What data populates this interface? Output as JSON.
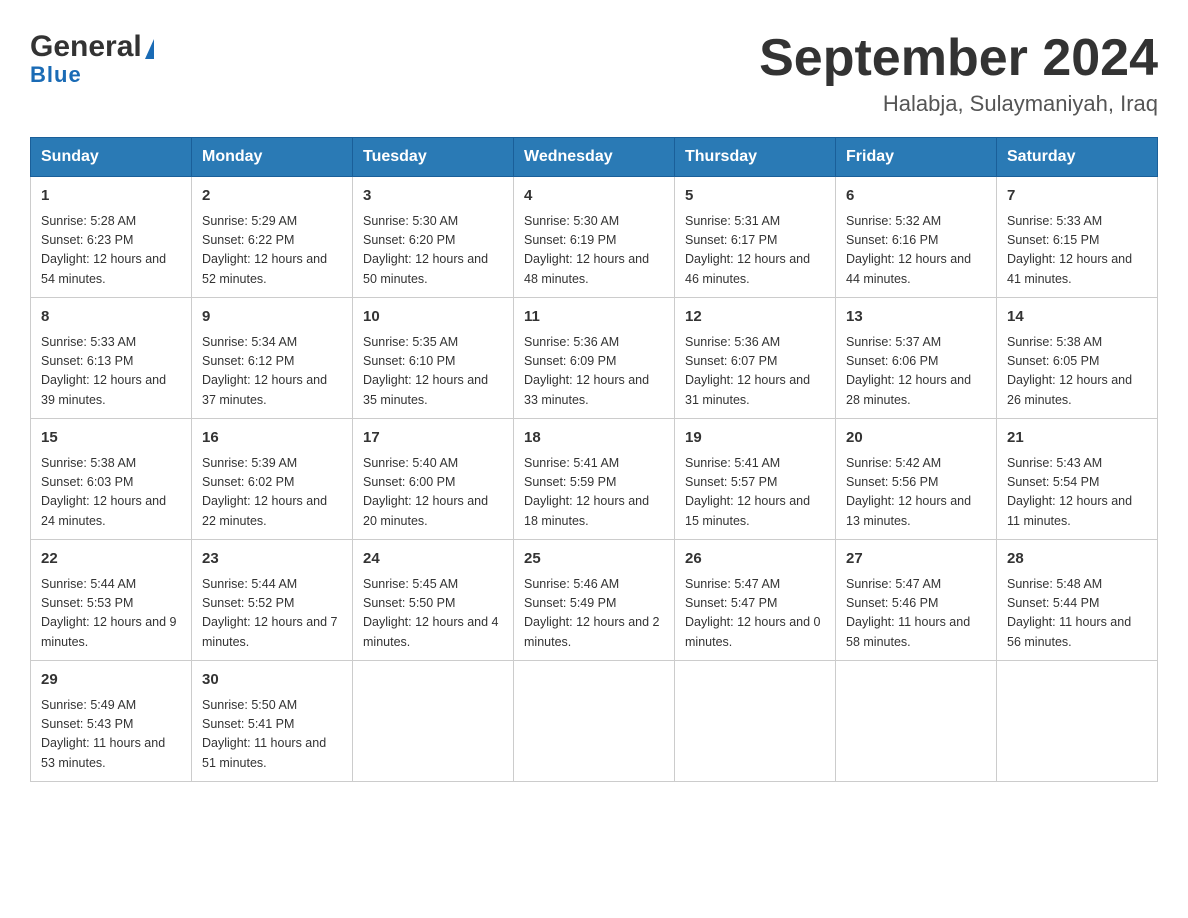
{
  "header": {
    "logo_line1": "General",
    "logo_line2": "Blue",
    "title": "September 2024",
    "subtitle": "Halabja, Sulaymaniyah, Iraq"
  },
  "weekdays": [
    "Sunday",
    "Monday",
    "Tuesday",
    "Wednesday",
    "Thursday",
    "Friday",
    "Saturday"
  ],
  "weeks": [
    [
      {
        "day": "1",
        "sunrise": "5:28 AM",
        "sunset": "6:23 PM",
        "daylight": "12 hours and 54 minutes."
      },
      {
        "day": "2",
        "sunrise": "5:29 AM",
        "sunset": "6:22 PM",
        "daylight": "12 hours and 52 minutes."
      },
      {
        "day": "3",
        "sunrise": "5:30 AM",
        "sunset": "6:20 PM",
        "daylight": "12 hours and 50 minutes."
      },
      {
        "day": "4",
        "sunrise": "5:30 AM",
        "sunset": "6:19 PM",
        "daylight": "12 hours and 48 minutes."
      },
      {
        "day": "5",
        "sunrise": "5:31 AM",
        "sunset": "6:17 PM",
        "daylight": "12 hours and 46 minutes."
      },
      {
        "day": "6",
        "sunrise": "5:32 AM",
        "sunset": "6:16 PM",
        "daylight": "12 hours and 44 minutes."
      },
      {
        "day": "7",
        "sunrise": "5:33 AM",
        "sunset": "6:15 PM",
        "daylight": "12 hours and 41 minutes."
      }
    ],
    [
      {
        "day": "8",
        "sunrise": "5:33 AM",
        "sunset": "6:13 PM",
        "daylight": "12 hours and 39 minutes."
      },
      {
        "day": "9",
        "sunrise": "5:34 AM",
        "sunset": "6:12 PM",
        "daylight": "12 hours and 37 minutes."
      },
      {
        "day": "10",
        "sunrise": "5:35 AM",
        "sunset": "6:10 PM",
        "daylight": "12 hours and 35 minutes."
      },
      {
        "day": "11",
        "sunrise": "5:36 AM",
        "sunset": "6:09 PM",
        "daylight": "12 hours and 33 minutes."
      },
      {
        "day": "12",
        "sunrise": "5:36 AM",
        "sunset": "6:07 PM",
        "daylight": "12 hours and 31 minutes."
      },
      {
        "day": "13",
        "sunrise": "5:37 AM",
        "sunset": "6:06 PM",
        "daylight": "12 hours and 28 minutes."
      },
      {
        "day": "14",
        "sunrise": "5:38 AM",
        "sunset": "6:05 PM",
        "daylight": "12 hours and 26 minutes."
      }
    ],
    [
      {
        "day": "15",
        "sunrise": "5:38 AM",
        "sunset": "6:03 PM",
        "daylight": "12 hours and 24 minutes."
      },
      {
        "day": "16",
        "sunrise": "5:39 AM",
        "sunset": "6:02 PM",
        "daylight": "12 hours and 22 minutes."
      },
      {
        "day": "17",
        "sunrise": "5:40 AM",
        "sunset": "6:00 PM",
        "daylight": "12 hours and 20 minutes."
      },
      {
        "day": "18",
        "sunrise": "5:41 AM",
        "sunset": "5:59 PM",
        "daylight": "12 hours and 18 minutes."
      },
      {
        "day": "19",
        "sunrise": "5:41 AM",
        "sunset": "5:57 PM",
        "daylight": "12 hours and 15 minutes."
      },
      {
        "day": "20",
        "sunrise": "5:42 AM",
        "sunset": "5:56 PM",
        "daylight": "12 hours and 13 minutes."
      },
      {
        "day": "21",
        "sunrise": "5:43 AM",
        "sunset": "5:54 PM",
        "daylight": "12 hours and 11 minutes."
      }
    ],
    [
      {
        "day": "22",
        "sunrise": "5:44 AM",
        "sunset": "5:53 PM",
        "daylight": "12 hours and 9 minutes."
      },
      {
        "day": "23",
        "sunrise": "5:44 AM",
        "sunset": "5:52 PM",
        "daylight": "12 hours and 7 minutes."
      },
      {
        "day": "24",
        "sunrise": "5:45 AM",
        "sunset": "5:50 PM",
        "daylight": "12 hours and 4 minutes."
      },
      {
        "day": "25",
        "sunrise": "5:46 AM",
        "sunset": "5:49 PM",
        "daylight": "12 hours and 2 minutes."
      },
      {
        "day": "26",
        "sunrise": "5:47 AM",
        "sunset": "5:47 PM",
        "daylight": "12 hours and 0 minutes."
      },
      {
        "day": "27",
        "sunrise": "5:47 AM",
        "sunset": "5:46 PM",
        "daylight": "11 hours and 58 minutes."
      },
      {
        "day": "28",
        "sunrise": "5:48 AM",
        "sunset": "5:44 PM",
        "daylight": "11 hours and 56 minutes."
      }
    ],
    [
      {
        "day": "29",
        "sunrise": "5:49 AM",
        "sunset": "5:43 PM",
        "daylight": "11 hours and 53 minutes."
      },
      {
        "day": "30",
        "sunrise": "5:50 AM",
        "sunset": "5:41 PM",
        "daylight": "11 hours and 51 minutes."
      },
      null,
      null,
      null,
      null,
      null
    ]
  ]
}
